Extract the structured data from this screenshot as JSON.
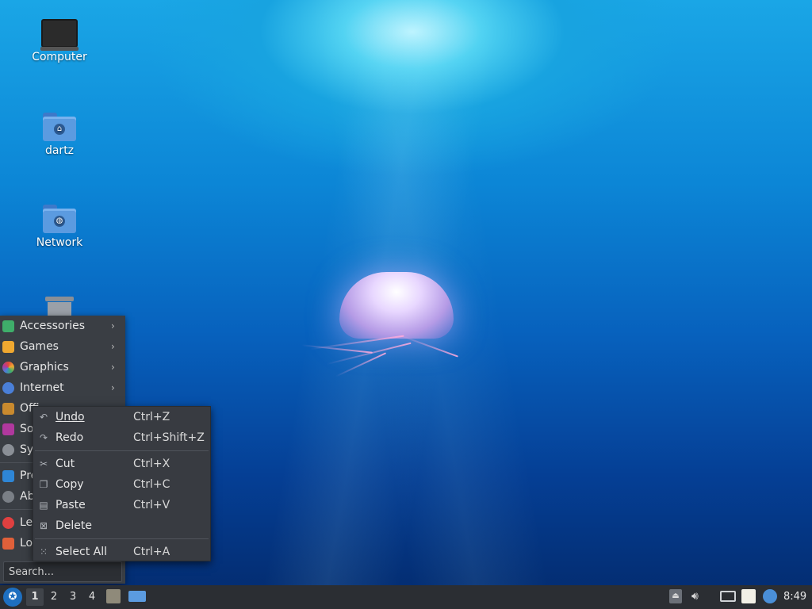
{
  "desktop": {
    "icons": [
      {
        "label": "Computer"
      },
      {
        "label": "dartz"
      },
      {
        "label": "Network"
      },
      {
        "label": ""
      }
    ]
  },
  "app_menu": {
    "items": [
      {
        "label": "Accessories",
        "icon": "accessories-icon",
        "color": "#3fae6a",
        "submenu": true
      },
      {
        "label": "Games",
        "icon": "games-icon",
        "color": "#f0a830",
        "submenu": true
      },
      {
        "label": "Graphics",
        "icon": "graphics-icon",
        "color": "#e0483c",
        "submenu": true
      },
      {
        "label": "Internet",
        "icon": "internet-icon",
        "color": "#4a7fd8",
        "submenu": true
      },
      {
        "label": "Offi",
        "icon": "office-icon",
        "color": "#c98a2e",
        "submenu": true
      },
      {
        "label": "Sou",
        "icon": "sound-video-icon",
        "color": "#b0389e",
        "submenu": true
      },
      {
        "label": "Sys",
        "icon": "system-icon",
        "color": "#8a8f96",
        "submenu": true
      },
      {
        "label": "Pre",
        "icon": "preferences-icon",
        "color": "#2e86d6",
        "submenu": false
      },
      {
        "label": "Ab",
        "icon": "about-icon",
        "color": "#7a7f86",
        "submenu": false
      },
      {
        "label": "Lea",
        "icon": "leave-icon",
        "color": "#e04040",
        "submenu": false
      },
      {
        "label": "Loc",
        "icon": "lock-icon",
        "color": "#e0603a",
        "submenu": false
      }
    ],
    "search_placeholder": "Search..."
  },
  "context_menu": {
    "items": [
      {
        "label": "Undo",
        "accel": "Ctrl+Z",
        "icon": "undo-icon"
      },
      {
        "label": "Redo",
        "accel": "Ctrl+Shift+Z",
        "icon": "redo-icon"
      },
      {
        "label": "Cut",
        "accel": "Ctrl+X",
        "icon": "scissors-icon"
      },
      {
        "label": "Copy",
        "accel": "Ctrl+C",
        "icon": "copy-icon"
      },
      {
        "label": "Paste",
        "accel": "Ctrl+V",
        "icon": "paste-icon"
      },
      {
        "label": "Delete",
        "accel": "",
        "icon": "delete-icon"
      },
      {
        "label": "Select All",
        "accel": "Ctrl+A",
        "icon": "select-all-icon"
      }
    ]
  },
  "panel": {
    "workspaces": [
      "1",
      "2",
      "3",
      "4"
    ],
    "active_workspace": "1",
    "clock": "8:49"
  },
  "colors": {
    "menu_bg": "#3a3e44",
    "panel_bg": "#2b2e33",
    "accent": "#1e6fc0"
  }
}
